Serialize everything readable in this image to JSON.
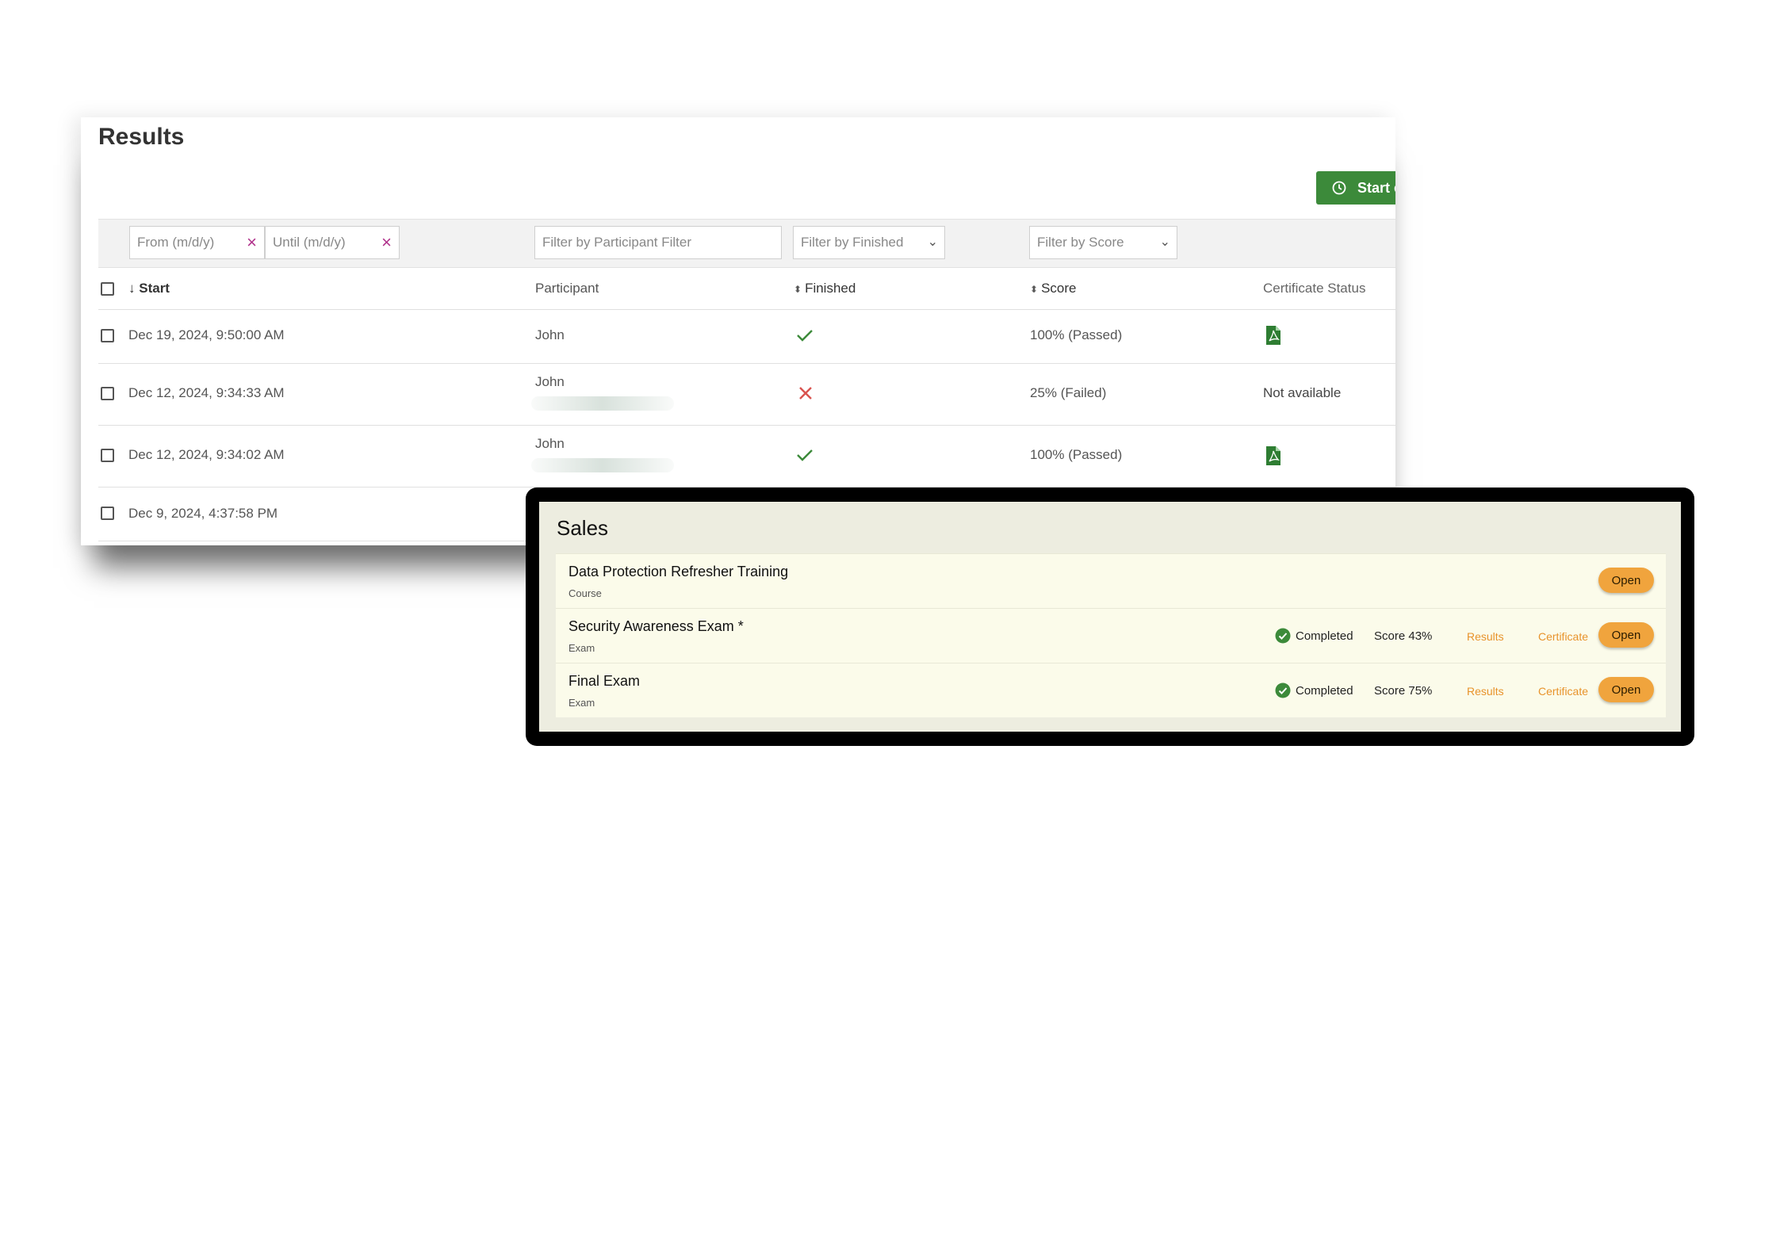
{
  "results": {
    "title": "Results",
    "start_button_label": "Start e",
    "filters": {
      "from_placeholder": "From (m/d/y)",
      "until_placeholder": "Until (m/d/y)",
      "clear_symbol": "×",
      "participant_placeholder": "Filter by Participant Filter",
      "finished_placeholder": "Filter by Finished",
      "score_placeholder": "Filter by Score"
    },
    "columns": {
      "start": "Start",
      "participant": "Participant",
      "finished": "Finished",
      "score": "Score",
      "certificate_status": "Certificate Status"
    },
    "rows": [
      {
        "start": "Dec 19, 2024, 9:50:00 AM",
        "participant": "John",
        "finished": "check",
        "score": "100% (Passed)",
        "certificate": "pdf-icon"
      },
      {
        "start": "Dec 12, 2024, 9:34:33 AM",
        "participant": "John",
        "finished": "x",
        "score": "25% (Failed)",
        "certificate": "Not available"
      },
      {
        "start": "Dec 12, 2024, 9:34:02 AM",
        "participant": "John",
        "finished": "check",
        "score": "100% (Passed)",
        "certificate": "pdf-icon"
      },
      {
        "start": "Dec 9, 2024, 4:37:58 PM",
        "participant": "",
        "finished": "",
        "score": "",
        "certificate": ""
      }
    ]
  },
  "sales": {
    "title": "Sales",
    "items": [
      {
        "title": "Data Protection Refresher Training",
        "type": "Course",
        "open_label": "Open"
      },
      {
        "title": "Security Awareness Exam *",
        "type": "Exam",
        "status": "Completed",
        "score": "Score 43%",
        "results_link": "Results",
        "certificate_link": "Certificate",
        "open_label": "Open"
      },
      {
        "title": "Final Exam",
        "type": "Exam",
        "status": "Completed",
        "score": "Score 75%",
        "results_link": "Results",
        "certificate_link": "Certificate",
        "open_label": "Open"
      }
    ]
  },
  "colors": {
    "accent_green": "#3c8a3a",
    "fail_red": "#d9534f",
    "open_button": "#f0a43d",
    "link_orange": "#e8932b"
  }
}
